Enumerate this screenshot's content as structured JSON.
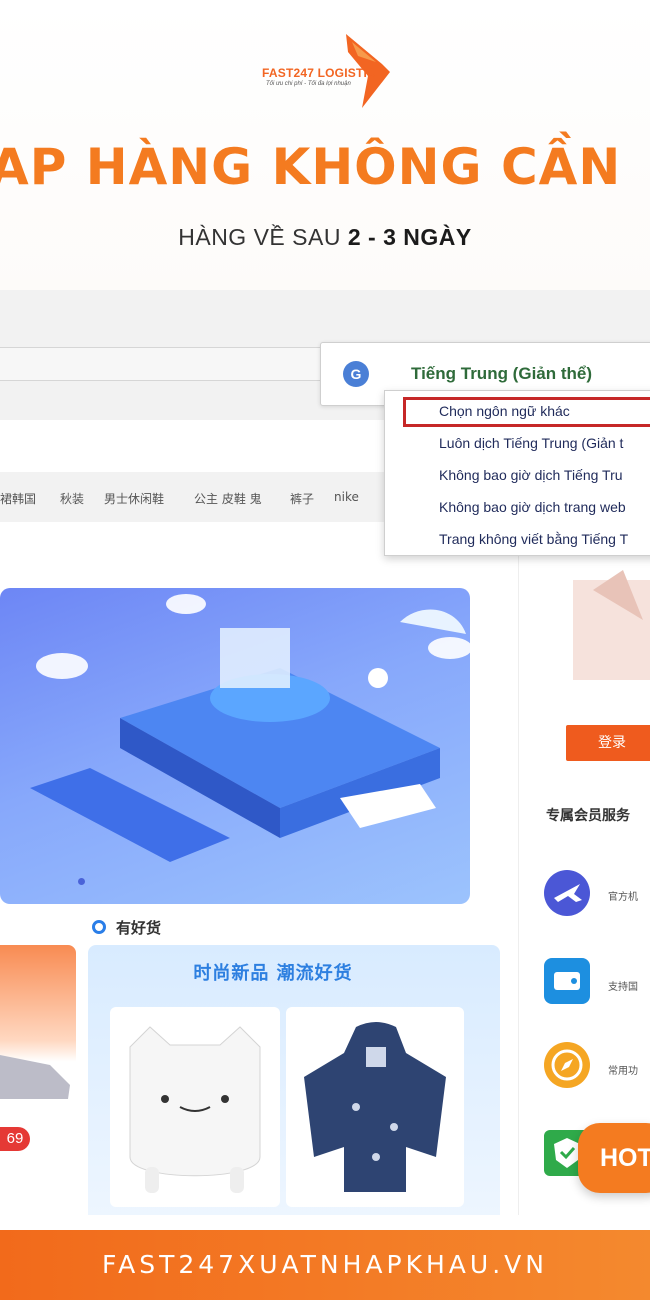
{
  "brand": {
    "logo_text": "FAST247 LOGISTIC",
    "logo_tagline": "Tối ưu chi phí - Tối đa lợi nhuận"
  },
  "headline": "AP HÀNG KHÔNG CẦN",
  "subheadline": {
    "prefix": "HÀNG VỀ SAU ",
    "highlight": "2 - 3 NGÀY"
  },
  "translate_bar": {
    "icon": "google-translate-icon",
    "current_language": "Tiếng Trung (Giản thể)",
    "menu_items": [
      "Chọn ngôn ngữ khác",
      "Luôn dịch Tiếng Trung (Giản t",
      "Không bao giờ dịch Tiếng Tru",
      "Không bao giờ dịch trang web",
      "Trang không viết bằng Tiếng T"
    ],
    "highlighted_index": 0
  },
  "category_strip": [
    "裙韩国",
    "秋装",
    "男士休闲鞋",
    "公主 皮鞋 鬼",
    "裤子",
    "nike",
    "..."
  ],
  "good_section": {
    "title": "有好货",
    "card_title": "时尚新品 潮流好货"
  },
  "left_card": {
    "price": "69"
  },
  "sidebar": {
    "login_label": "登录",
    "member_title": "专属会员服务",
    "services": [
      {
        "icon": "plane-icon",
        "text": "官方机"
      },
      {
        "icon": "wallet-icon",
        "text": "支持国"
      },
      {
        "icon": "compass-icon",
        "text": "常用功"
      },
      {
        "icon": "shield-icon",
        "text": ""
      }
    ]
  },
  "hot_button": "HOT",
  "footer": "FAST247XUATNHAPKHAU.VN",
  "colors": {
    "brand_orange": "#f47b20",
    "highlight_red": "#c62828",
    "login_orange": "#ef5b1e",
    "blue_accent": "#2d7fe0"
  }
}
